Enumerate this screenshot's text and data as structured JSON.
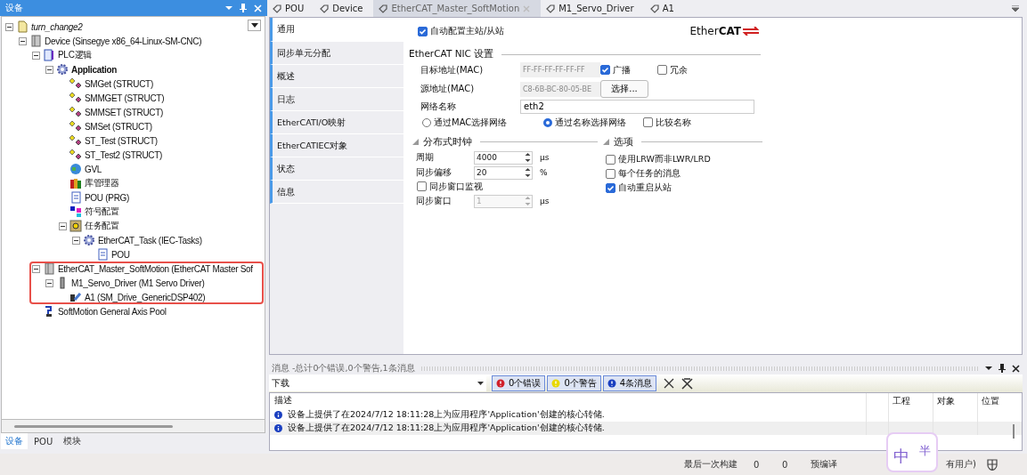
{
  "devices_panel": {
    "title": "设备",
    "tree": [
      {
        "label": "turn_change2",
        "kind": "project",
        "expanded": true,
        "highlighted": false,
        "children": [
          {
            "label": "Device (Sinsegye x86_64-Linux-SM-CNC)",
            "kind": "device",
            "expanded": true,
            "highlighted": false,
            "children": [
              {
                "label": "PLC逻辑",
                "kind": "plc",
                "expanded": true,
                "highlighted": false,
                "children": [
                  {
                    "label": "Application",
                    "kind": "application",
                    "expanded": true,
                    "highlighted": false,
                    "children": [
                      {
                        "label": "SMGet (STRUCT)",
                        "kind": "struct",
                        "highlighted": false
                      },
                      {
                        "label": "SMMGET (STRUCT)",
                        "kind": "struct",
                        "highlighted": false
                      },
                      {
                        "label": "SMMSET (STRUCT)",
                        "kind": "struct",
                        "highlighted": false
                      },
                      {
                        "label": "SMSet (STRUCT)",
                        "kind": "struct",
                        "highlighted": false
                      },
                      {
                        "label": "ST_Test (STRUCT)",
                        "kind": "struct",
                        "highlighted": false
                      },
                      {
                        "label": "ST_Test2 (STRUCT)",
                        "kind": "struct",
                        "highlighted": false
                      },
                      {
                        "label": "GVL",
                        "kind": "gvl",
                        "highlighted": false
                      },
                      {
                        "label": "库管理器",
                        "kind": "library",
                        "highlighted": false
                      },
                      {
                        "label": "POU (PRG)",
                        "kind": "pou",
                        "highlighted": false
                      },
                      {
                        "label": "符号配置",
                        "kind": "symbol",
                        "highlighted": false
                      },
                      {
                        "label": "任务配置",
                        "kind": "tasks",
                        "expanded": true,
                        "highlighted": false,
                        "children": [
                          {
                            "label": "EtherCAT_Task (IEC-Tasks)",
                            "kind": "task",
                            "expanded": true,
                            "highlighted": false,
                            "children": [
                              {
                                "label": "POU",
                                "kind": "call",
                                "highlighted": false
                              }
                            ]
                          }
                        ]
                      }
                    ]
                  }
                ]
              },
              {
                "label": "EtherCAT_Master_SoftMotion (EtherCAT Master Sof",
                "kind": "device",
                "expanded": true,
                "highlighted": true,
                "children": [
                  {
                    "label": "M1_Servo_Driver (M1 Servo Driver)",
                    "kind": "driver",
                    "expanded": true,
                    "highlighted": false,
                    "children": [
                      {
                        "label": "A1 (SM_Drive_GenericDSP402)",
                        "kind": "axis",
                        "highlighted": false
                      }
                    ]
                  }
                ]
              },
              {
                "label": "SoftMotion General Axis Pool",
                "kind": "axis_pool",
                "highlighted": false
              }
            ]
          }
        ]
      }
    ],
    "bottom_tabs": [
      {
        "label": "设备",
        "selected": true
      },
      {
        "label": "POU",
        "selected": false
      },
      {
        "label": "模块",
        "selected": false
      }
    ]
  },
  "editor_tabs": [
    {
      "label": "POU",
      "selected": false,
      "closable": false
    },
    {
      "label": "Device",
      "selected": false,
      "closable": false
    },
    {
      "label": "EtherCAT_Master_SoftMotion",
      "selected": true,
      "closable": true
    },
    {
      "label": "M1_Servo_Driver",
      "selected": false,
      "closable": false
    },
    {
      "label": "A1",
      "selected": false,
      "closable": false
    }
  ],
  "side_tabs": [
    {
      "label": "通用",
      "selected": true
    },
    {
      "label": "同步单元分配",
      "selected": false
    },
    {
      "label": "概述",
      "selected": false
    },
    {
      "label": "日志",
      "selected": false
    },
    {
      "label": "EtherCATI/O映射",
      "selected": false
    },
    {
      "label": "EtherCATIEC对象",
      "selected": false
    },
    {
      "label": "状态",
      "selected": false
    },
    {
      "label": "信息",
      "selected": false
    }
  ],
  "general": {
    "auto_config": {
      "label": "自动配置主站/从站",
      "checked": true
    },
    "logo": "Ether**CAT**",
    "nic": {
      "title": "EtherCAT NIC 设置",
      "dest_mac": {
        "label": "目标地址(MAC)",
        "value": "FF-FF-FF-FF-FF-FF"
      },
      "broadcast": {
        "label": "广播",
        "checked": true
      },
      "redundancy": {
        "label": "冗余",
        "checked": false
      },
      "src_mac": {
        "label": "源地址(MAC)",
        "value": "C8-6B-BC-80-05-BE"
      },
      "select_button": "选择...",
      "network_name": {
        "label": "网络名称",
        "value": "eth2"
      },
      "radios": [
        {
          "label": "通过MAC选择网络",
          "selected": false
        },
        {
          "label": "通过名称选择网络",
          "selected": true
        }
      ],
      "compare_name": {
        "label": "比较名称",
        "checked": false
      }
    },
    "dc": {
      "title": "分布式时钟",
      "expanded": true,
      "cycle": {
        "label": "周期",
        "value": "4000",
        "unit": "μs"
      },
      "offset": {
        "label": "同步偏移",
        "value": "20",
        "unit": "%"
      },
      "watch": {
        "label": "同步窗口监视",
        "checked": false
      },
      "window": {
        "label": "同步窗口",
        "value": "1",
        "unit": "μs",
        "disabled": true
      }
    },
    "options": {
      "title": "选项",
      "expanded": true,
      "items": [
        {
          "label": "使用LRW而非LWR/LRD",
          "checked": false
        },
        {
          "label": "每个任务的消息",
          "checked": false
        },
        {
          "label": "自动重启从站",
          "checked": true
        }
      ]
    }
  },
  "messages": {
    "title": "消息 -总计0个错误,0个警告,1条消息",
    "source": "下载",
    "filters": [
      {
        "kind": "error",
        "label": "0个错误"
      },
      {
        "kind": "warning",
        "label": "0个警告"
      },
      {
        "kind": "info",
        "label": "4条消息"
      }
    ],
    "columns": [
      "描述",
      "工程",
      "对象",
      "位置"
    ],
    "rows": [
      {
        "kind": "info",
        "text": "设备上提供了在2024/7/12 18:11:28上为应用程序'Application'创建的核心转储."
      },
      {
        "kind": "info",
        "text": "设备上提供了在2024/7/12 18:11:28上为应用程序'Application'创建的核心转储."
      }
    ]
  },
  "status_bar": {
    "last_build": "最后一次构建",
    "errors": "0",
    "warnings": "0",
    "precompile": "预编译",
    "user": "有用户)"
  },
  "ime_badge": {
    "main": "中",
    "mode": "半"
  }
}
